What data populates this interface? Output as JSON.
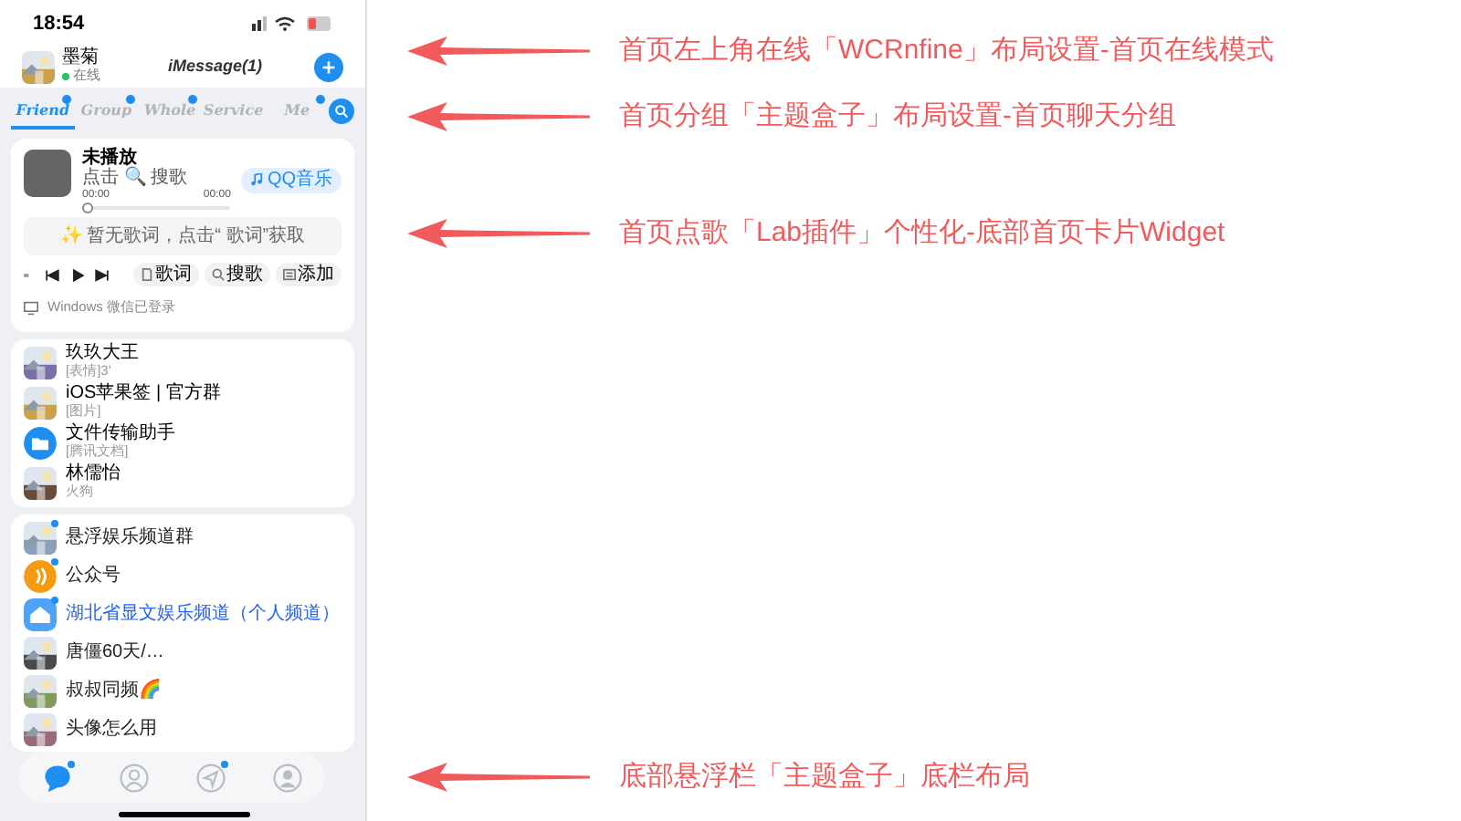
{
  "status_bar": {
    "time": "18:54"
  },
  "header": {
    "name": "墨菊",
    "status": "在线",
    "online": true,
    "title": "iMessage(1)"
  },
  "tabs": [
    {
      "label": "Friend",
      "selected": true,
      "badge": true
    },
    {
      "label": "Group",
      "selected": false,
      "badge": true
    },
    {
      "label": "Whole",
      "selected": false,
      "badge": true
    },
    {
      "label": "Service",
      "selected": false,
      "badge": false
    },
    {
      "label": "Me",
      "selected": false,
      "badge": true
    }
  ],
  "music": {
    "title": "未播放",
    "hint": "点击 🔍 搜歌",
    "start": "00:00",
    "end": "00:00",
    "level": 0,
    "source": "QQ音乐",
    "lyrics": "✨ 暂无歌词，点击“ 歌词”获取",
    "actions": [
      {
        "label": "歌词",
        "kind": "lyrics"
      },
      {
        "label": "搜歌",
        "kind": "search"
      },
      {
        "label": "添加",
        "kind": "add"
      }
    ],
    "device": "Windows 微信已登录"
  },
  "pinned_chats": [
    {
      "name": "玖玖大王",
      "preview": "[表情]3'",
      "color": "#7a6fa8"
    },
    {
      "name": "iOS苹果签 | 官方群",
      "preview": "[图片]",
      "color": "#c9a24a"
    },
    {
      "name": "文件传输助手",
      "preview": "[腾讯文档]",
      "kind": "folder",
      "color": "#1f8ef1"
    },
    {
      "name": "林儒怡",
      "preview": "火狗",
      "color": "#6b4a3a"
    }
  ],
  "chats": [
    {
      "name": "悬浮娱乐频道群",
      "color": "#8aa0b8",
      "badge": true,
      "highlight": false
    },
    {
      "name": "公众号",
      "kind": "broadcast",
      "color": "#f39c12",
      "badge": true,
      "highlight": false
    },
    {
      "name": "湖北省显文娱乐频道（个人频道）",
      "kind": "home",
      "color": "#4fa3f7",
      "badge": true,
      "highlight": true
    },
    {
      "name": "唐僵60天/…",
      "color": "#4a4a4a",
      "badge": false,
      "highlight": false
    },
    {
      "name": "叔叔同频🌈",
      "color": "#7f9a5a",
      "badge": false,
      "highlight": false
    },
    {
      "name": "头像怎么用",
      "color": "#9a6a7a",
      "badge": false,
      "highlight": false
    }
  ],
  "dock": [
    {
      "kind": "chat",
      "selected": true,
      "badge": true
    },
    {
      "kind": "contacts",
      "selected": false,
      "badge": false
    },
    {
      "kind": "navigate",
      "selected": false,
      "badge": true
    },
    {
      "kind": "profile",
      "selected": false,
      "badge": false
    }
  ],
  "annotations": [
    "首页左上角在线「WCRnfine」布局设置-首页在线模式",
    "首页分组「主题盒子」布局设置-首页聊天分组",
    "首页点歌「Lab插件」个性化-底部首页卡片Widget",
    "底部悬浮栏「主题盒子」底栏布局"
  ]
}
